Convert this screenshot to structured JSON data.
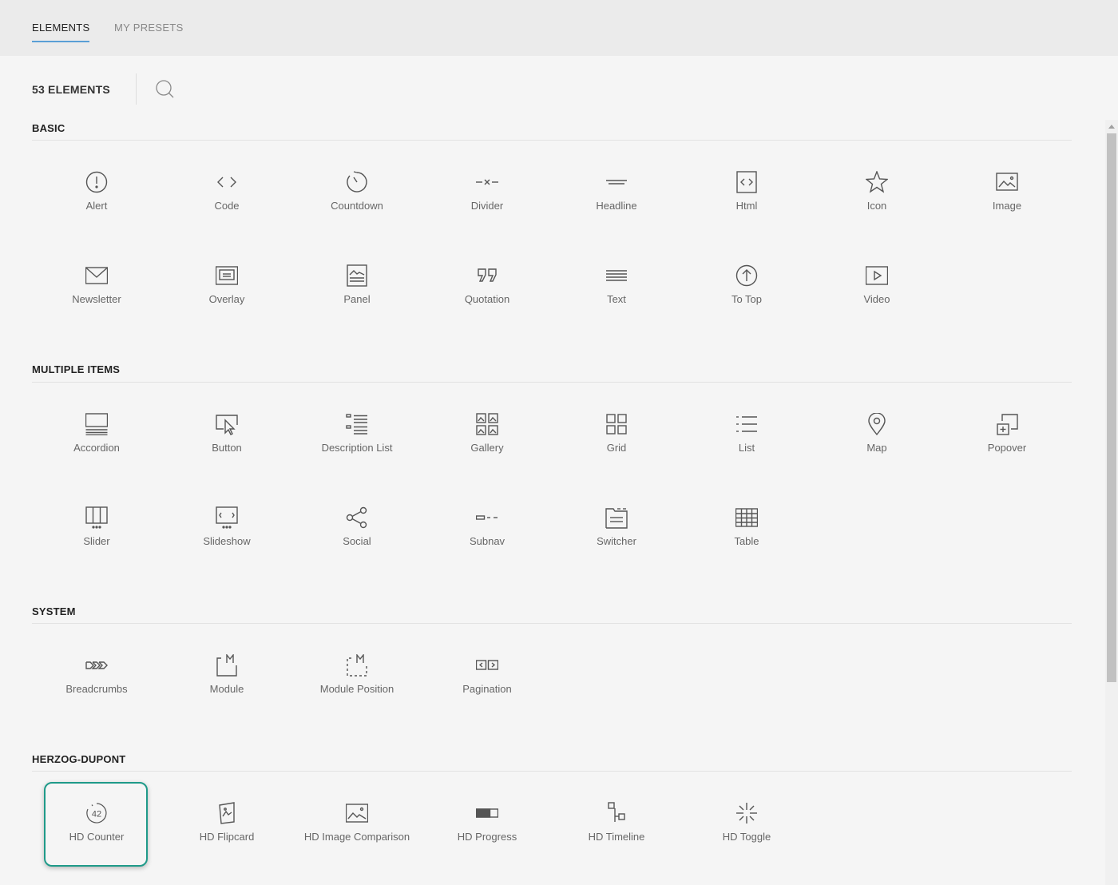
{
  "tabs": {
    "elements": "ELEMENTS",
    "presets": "MY PRESETS"
  },
  "count_label": "53 ELEMENTS",
  "accent_color": "#1f9a89",
  "sections": {
    "basic": {
      "title": "BASIC",
      "items": [
        {
          "label": "Alert",
          "icon": "alert-icon"
        },
        {
          "label": "Code",
          "icon": "code-icon"
        },
        {
          "label": "Countdown",
          "icon": "countdown-icon"
        },
        {
          "label": "Divider",
          "icon": "divider-icon"
        },
        {
          "label": "Headline",
          "icon": "headline-icon"
        },
        {
          "label": "Html",
          "icon": "html-icon"
        },
        {
          "label": "Icon",
          "icon": "star-icon"
        },
        {
          "label": "Image",
          "icon": "image-icon"
        },
        {
          "label": "Newsletter",
          "icon": "envelope-icon"
        },
        {
          "label": "Overlay",
          "icon": "overlay-icon"
        },
        {
          "label": "Panel",
          "icon": "panel-icon"
        },
        {
          "label": "Quotation",
          "icon": "quotation-icon"
        },
        {
          "label": "Text",
          "icon": "text-icon"
        },
        {
          "label": "To Top",
          "icon": "arrow-up-circle-icon"
        },
        {
          "label": "Video",
          "icon": "video-icon"
        }
      ]
    },
    "multiple": {
      "title": "MULTIPLE ITEMS",
      "items": [
        {
          "label": "Accordion",
          "icon": "accordion-icon"
        },
        {
          "label": "Button",
          "icon": "button-cursor-icon"
        },
        {
          "label": "Description List",
          "icon": "description-list-icon"
        },
        {
          "label": "Gallery",
          "icon": "gallery-icon"
        },
        {
          "label": "Grid",
          "icon": "grid-icon"
        },
        {
          "label": "List",
          "icon": "list-icon"
        },
        {
          "label": "Map",
          "icon": "map-pin-icon"
        },
        {
          "label": "Popover",
          "icon": "popover-icon"
        },
        {
          "label": "Slider",
          "icon": "slider-icon"
        },
        {
          "label": "Slideshow",
          "icon": "slideshow-icon"
        },
        {
          "label": "Social",
          "icon": "share-icon"
        },
        {
          "label": "Subnav",
          "icon": "subnav-icon"
        },
        {
          "label": "Switcher",
          "icon": "switcher-icon"
        },
        {
          "label": "Table",
          "icon": "table-icon"
        }
      ]
    },
    "system": {
      "title": "SYSTEM",
      "items": [
        {
          "label": "Breadcrumbs",
          "icon": "breadcrumbs-icon"
        },
        {
          "label": "Module",
          "icon": "module-icon"
        },
        {
          "label": "Module Position",
          "icon": "module-position-icon"
        },
        {
          "label": "Pagination",
          "icon": "pagination-icon"
        }
      ]
    },
    "hd": {
      "title": "HERZOG-DUPONT",
      "items": [
        {
          "label": "HD Counter",
          "icon": "counter-icon",
          "badge": "42"
        },
        {
          "label": "HD Flipcard",
          "icon": "flipcard-icon"
        },
        {
          "label": "HD Image Comparison",
          "icon": "image-comparison-icon"
        },
        {
          "label": "HD Progress",
          "icon": "progress-icon"
        },
        {
          "label": "HD Timeline",
          "icon": "timeline-icon"
        },
        {
          "label": "HD Toggle",
          "icon": "toggle-icon"
        }
      ]
    }
  }
}
